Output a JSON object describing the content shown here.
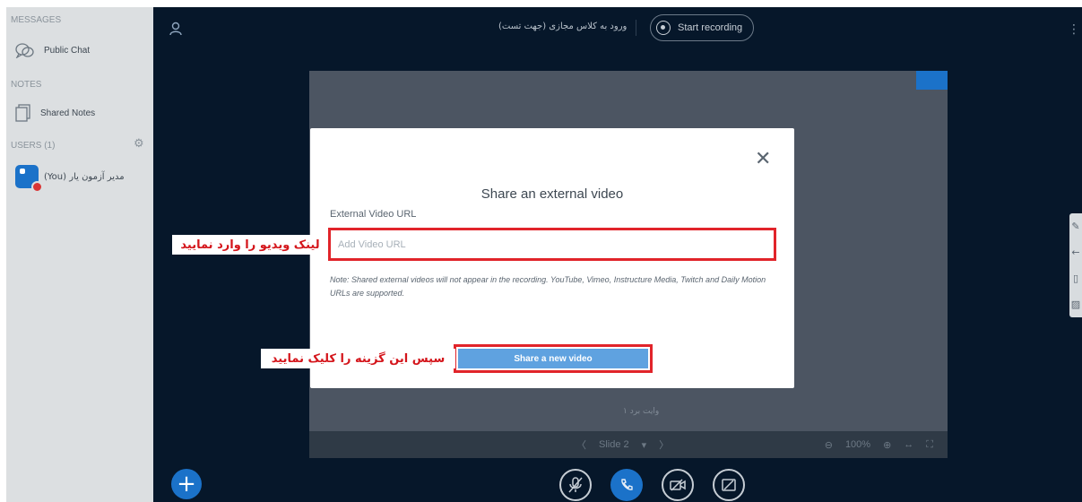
{
  "sidebar": {
    "messages_title": "MESSAGES",
    "public_chat": "Public Chat",
    "notes_title": "NOTES",
    "shared_notes": "Shared Notes",
    "users_title": "USERS (1)",
    "user_name": "مدیر آزمون یار (You)"
  },
  "topbar": {
    "meeting_title": "ورود به کلاس مجازی (جهت تست)",
    "record_label": "Start recording"
  },
  "presentation": {
    "slide_label": "Slide 2",
    "zoom": "100%",
    "bottom_text": "وایت برد ۱"
  },
  "modal": {
    "title": "Share an external video",
    "field_label": "External Video URL",
    "input_placeholder": "Add Video URL",
    "input_value": "",
    "note": "Note: Shared external videos will not appear in the recording. YouTube, Vimeo, Instructure Media, Twitch and Daily Motion URLs are supported.",
    "share_button": "Share a new video"
  },
  "annotations": {
    "enter_link": "لینک ویدیو را وارد نمایید",
    "click_option": "سپس این گزینه را کلیک نمایید"
  },
  "colors": {
    "accent": "#1b72c9",
    "highlight": "#e1242a",
    "dark_bg": "#06172a"
  },
  "icons": [
    "chat-icon",
    "notes-icon",
    "gear-icon",
    "user-icon",
    "record-icon",
    "close-icon",
    "plus-icon",
    "mic-off-icon",
    "phone-icon",
    "camera-off-icon",
    "screen-share-off-icon"
  ]
}
